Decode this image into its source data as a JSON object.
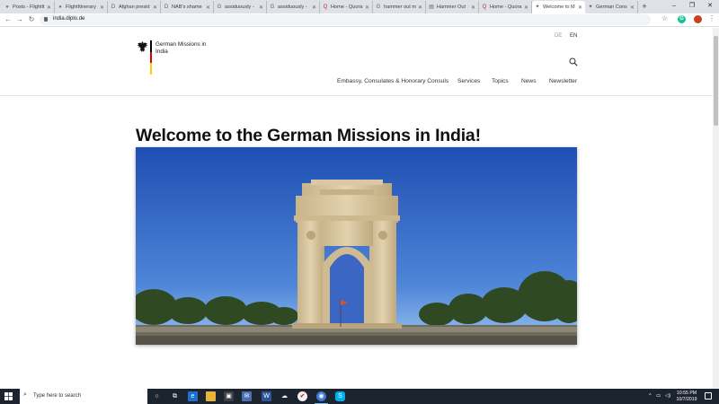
{
  "browser": {
    "tabs": [
      {
        "title": "Posts - Flightlt",
        "favicon": "pinterest-icon"
      },
      {
        "title": "FlightItinerary",
        "favicon": "pinterest-icon"
      },
      {
        "title": "Afghan presid",
        "favicon": "D"
      },
      {
        "title": "NAB's shame",
        "favicon": "D"
      },
      {
        "title": "assiduously -",
        "favicon": "G"
      },
      {
        "title": "assiduously -",
        "favicon": "G"
      },
      {
        "title": "Home - Quora",
        "favicon": "Q"
      },
      {
        "title": "hammer out m",
        "favicon": "G"
      },
      {
        "title": "Hammer Out",
        "favicon": "dictionary-icon"
      },
      {
        "title": "Home - Quora",
        "favicon": "Q"
      },
      {
        "title": "Welcome to M",
        "favicon": "eagle-icon",
        "active": true
      },
      {
        "title": "German Cons",
        "favicon": "eagle-icon"
      }
    ],
    "new_tab_glyph": "+",
    "window_controls": {
      "minimize": "–",
      "maximize": "❐",
      "close": "✕"
    },
    "url": "india.diplo.de",
    "extension_letter": "G"
  },
  "site": {
    "name_line1": "German Missions in",
    "name_line2": "India",
    "languages": [
      "DE",
      "EN"
    ],
    "active_language": "EN",
    "nav": [
      "Embassy, Consulates & Honorary Consuls",
      "Services",
      "Topics",
      "News",
      "Newsletter"
    ]
  },
  "main": {
    "headline": "Welcome to the German Missions in India!",
    "hero_subject": "India Gate, New Delhi"
  },
  "taskbar": {
    "search_placeholder": "Type here to search",
    "time": "10:55 PM",
    "date": "10/7/2019"
  },
  "colors": {
    "flag_black": "#000000",
    "flag_red": "#dd0000",
    "flag_gold": "#ffce00",
    "sky_top": "#1f4fb3",
    "sky_bottom": "#7fb1ea",
    "sandstone": "#d8c7a3",
    "taskbar": "#1c2430"
  }
}
